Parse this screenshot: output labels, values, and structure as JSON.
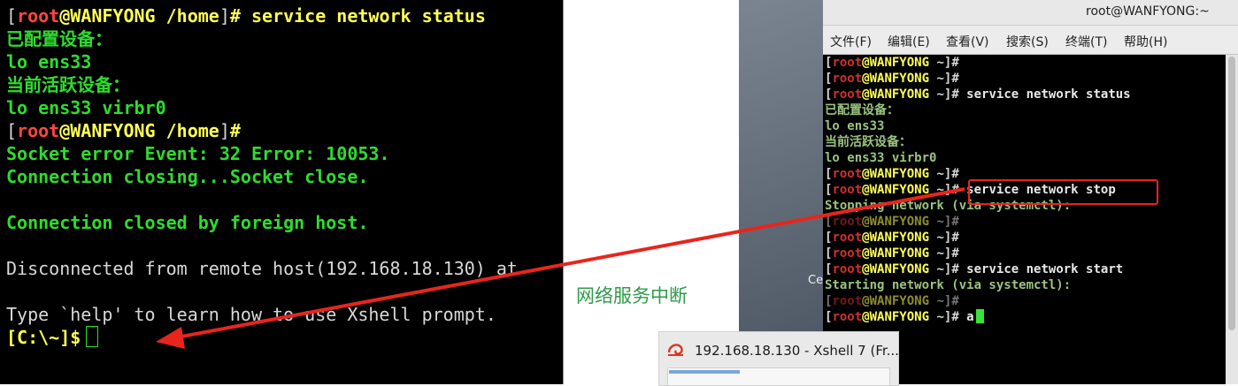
{
  "xshell": {
    "lines": [
      {
        "open": "[",
        "user": "root",
        "host": "@WANFYONG /home",
        "close": "]",
        "cmd": "# service network status"
      },
      {
        "text": "已配置设备："
      },
      {
        "text": "lo ens33"
      },
      {
        "text": "当前活跃设备："
      },
      {
        "text": "lo ens33 virbr0"
      },
      {
        "open": "[",
        "user": "root",
        "host": "@WANFYONG /home",
        "close": "]",
        "cmd": "#"
      },
      {
        "text": "Socket error Event: 32 Error: 10053."
      },
      {
        "text": "Connection closing...Socket close."
      },
      {
        "text": ""
      },
      {
        "text": "Connection closed by foreign host."
      },
      {
        "text": ""
      },
      {
        "text": "Disconnected from remote host(192.168.18.130) at"
      },
      {
        "text": ""
      },
      {
        "text": "Type `help' to learn how to use Xshell prompt."
      },
      {
        "prompt": "[C:\\~]$"
      }
    ]
  },
  "annotation": {
    "network_interrupt_note": "网络服务中断"
  },
  "desktop": {
    "label_fragment": "Ce"
  },
  "gnome_terminal": {
    "title": "root@WANFYONG:~",
    "menu": [
      "文件(F)",
      "编辑(E)",
      "查看(V)",
      "搜索(S)",
      "终端(T)",
      "帮助(H)"
    ],
    "prompt": {
      "open": "[",
      "user": "root",
      "host": "@WANFYONG",
      "path": " ~",
      "close": "]",
      "hash": "#"
    },
    "lines": [
      {
        "type": "prompt",
        "cmd": ""
      },
      {
        "type": "prompt",
        "cmd": ""
      },
      {
        "type": "prompt",
        "cmd": " service network status"
      },
      {
        "type": "text",
        "text": "已配置设备："
      },
      {
        "type": "text",
        "text": "lo ens33"
      },
      {
        "type": "text",
        "text": "当前活跃设备："
      },
      {
        "type": "text",
        "text": "lo ens33 virbr0"
      },
      {
        "type": "prompt",
        "cmd": ""
      },
      {
        "type": "prompt",
        "cmd": " service network stop"
      },
      {
        "type": "text",
        "text": "Stopping network (via systemctl):"
      },
      {
        "type": "prompt",
        "cmd": "",
        "dim": true
      },
      {
        "type": "prompt",
        "cmd": ""
      },
      {
        "type": "prompt",
        "cmd": ""
      },
      {
        "type": "prompt",
        "cmd": " service network start"
      },
      {
        "type": "text",
        "text": "Starting network (via systemctl):"
      },
      {
        "type": "prompt",
        "cmd": "",
        "dim": true
      },
      {
        "type": "prompt",
        "cmd": " a",
        "cursor": true
      }
    ]
  },
  "taskbar_thumbnail": {
    "title": "192.168.18.130 - Xshell 7 (Fr..."
  },
  "colors": {
    "highlight": "#e8251d",
    "arrow": "#e8251d",
    "terminal_green": "#2fdc2f",
    "note_green": "#2f9a4a"
  }
}
